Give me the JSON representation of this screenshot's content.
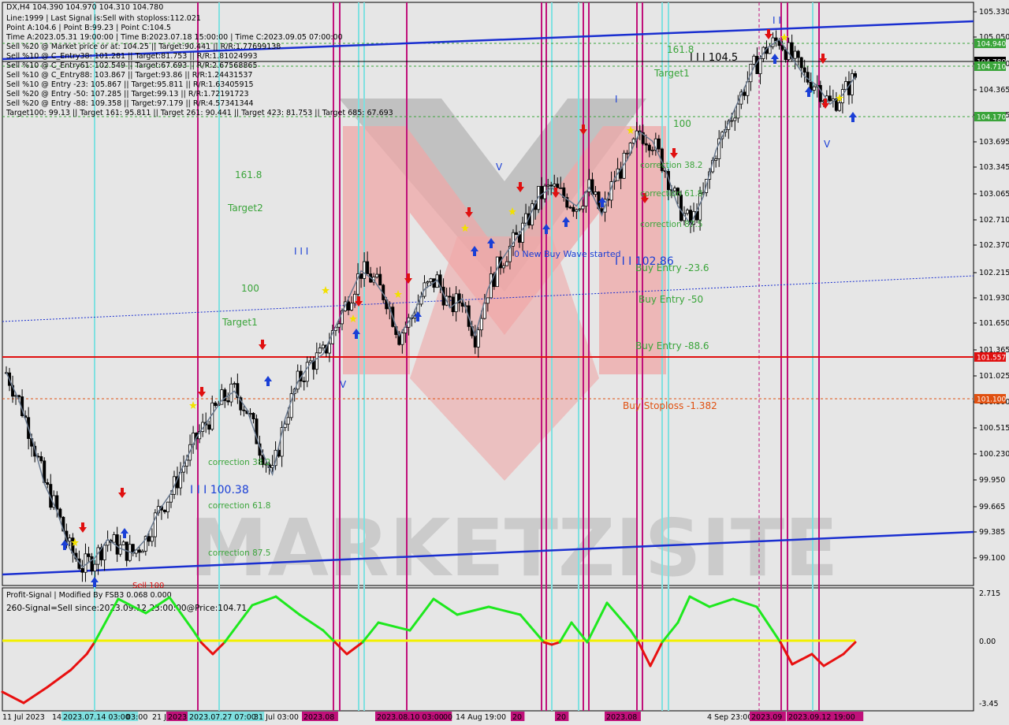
{
  "header": {
    "symbol_line": "DX,H4  104.390 104.970 104.310 104.780",
    "info_lines": [
      "Line:1999 | Last Signal is:Sell with stoploss:112.021",
      "Point A:104.6 | Point B:99.23 | Point C:104.5",
      "Time A:2023.05.31 19:00:00 | Time B:2023.07.18 15:00:00 | Time C:2023.09.05 07:00:00",
      "Sell %20 @ Market price or at: 104.25 || Target:90.441 || R/R:1.77699138",
      "Sell %10 @ C_Entry38: 101.281 || Target:81.753 || R/R:1.81024993",
      "Sell %10 @ C_Entry61: 102.549 || Target:67.693 || R/R:2.67568865",
      "Sell %10 @ C_Entry88: 103.867 || Target:93.86 || R/R:1.24431537",
      "Sell %10 @ Entry -23: 105.867 || Target:95.811 || R/R:1.63405915",
      "Sell %20 @ Entry -50: 107.285 || Target:99.13 || R/R:1.72191723",
      "Sell %20 @ Entry -88: 109.358 || Target:97.179 || R/R:4.57341344",
      "Target100: 99.13 || Target 161: 95.811 || Target 261: 90.441 || Target 423: 81.753 || Target 685: 67.693"
    ]
  },
  "price_axis": {
    "ticks": [
      "105.330",
      "105.050",
      "104.710",
      "104.365",
      "104.035",
      "103.695",
      "103.345",
      "103.065",
      "102.710",
      "102.370",
      "102.215",
      "101.930",
      "101.650",
      "101.365",
      "101.025",
      "100.800",
      "100.515",
      "100.230",
      "99.950",
      "99.665",
      "99.385",
      "99.100"
    ],
    "tags": [
      {
        "text": "104.940",
        "color": "#3aa43a"
      },
      {
        "text": "104.780",
        "color": "#000000"
      },
      {
        "text": "104.710",
        "color": "#3aa43a"
      },
      {
        "text": "104.170",
        "color": "#3aa43a"
      },
      {
        "text": "101.557",
        "color": "#e01010"
      },
      {
        "text": "101.100",
        "color": "#e05010"
      }
    ]
  },
  "time_axis": {
    "labels": [
      {
        "text": "11 Jul 2023",
        "hl": false
      },
      {
        "text": "14",
        "hl": false
      },
      {
        "text": "2023.07.14 03:00",
        "hl": true,
        "color": "cyan"
      },
      {
        "text": "03:00",
        "hl": false
      },
      {
        "text": "21 J",
        "hl": false
      },
      {
        "text": "2023",
        "hl": true,
        "color": "magenta"
      },
      {
        "text": "2023.07.27 07:00",
        "hl": true,
        "color": "cyan"
      },
      {
        "text": "31 Jul 03:00",
        "hl": false
      },
      {
        "text": "2023.08",
        "hl": true,
        "color": "magenta"
      },
      {
        "text": "2023.08.10 03:00",
        "hl": true,
        "color": "magenta"
      },
      {
        "text": "00",
        "hl": false
      },
      {
        "text": "14 Aug 19:00",
        "hl": false
      },
      {
        "text": "20",
        "hl": true,
        "color": "magenta"
      },
      {
        "text": "20",
        "hl": true,
        "color": "magenta"
      },
      {
        "text": "2023.08",
        "hl": true,
        "color": "magenta"
      },
      {
        "text": "4 Sep 23:00",
        "hl": false
      },
      {
        "text": "2023.09",
        "hl": true,
        "color": "magenta"
      },
      {
        "text": "2023.09.12 19:00",
        "hl": true,
        "color": "magenta"
      }
    ]
  },
  "annotations": {
    "green": [
      "161.8",
      "Target2",
      "100",
      "Target1",
      "correction 38.2",
      "correction 61.8",
      "correction 87.5",
      "161.8",
      "Target1",
      "100",
      "correction 38.2",
      "correction 61.8",
      "correction 87.5",
      "Buy Entry -23.6",
      "Buy Entry -50",
      "Buy Entry -88.6"
    ],
    "blue": [
      "I I I",
      "I I I 100.38",
      "0 New Buy Wave started",
      "I I I 102.86",
      "V",
      "V",
      "I",
      "V",
      "I I"
    ],
    "red": [
      "Buy Stoploss -1.382",
      "Sell 100"
    ],
    "ticker_text": "I I I 104.5"
  },
  "indicator": {
    "title": "Profit-Signal | Modified By FSB3 0.068 0.000",
    "signal_text": "260-Signal=Sell since:2023.09.12 23:00:00@Price:104.71",
    "ticks": [
      "2.715",
      "0.00",
      "-3.45"
    ]
  },
  "watermark": {
    "text": "MARKETZISITE"
  },
  "colors": {
    "background": "#e6e6e6",
    "bull_candle": "#000000",
    "ma_line": "#6a7a90",
    "trend_line": "#1a2fd0",
    "support_red": "#e01010",
    "stop_orange": "#e05010",
    "target_green": "#3aa43a",
    "vline_magenta": "#c0107a",
    "vline_cyan": "#7fe0e0",
    "osc_up": "#1ee81e",
    "osc_down": "#e81010",
    "osc_zero": "#f2f000"
  },
  "chart_data": {
    "type": "candlestick",
    "symbol": "DX,H4",
    "ylim": [
      99.1,
      105.4
    ],
    "series_close": [
      101.4,
      101.1,
      100.7,
      100.2,
      99.9,
      99.5,
      99.3,
      99.4,
      99.6,
      99.5,
      99.45,
      99.6,
      99.9,
      100.1,
      100.4,
      100.7,
      100.9,
      101.1,
      101.2,
      101.0,
      100.6,
      100.3,
      100.9,
      101.3,
      101.5,
      101.6,
      101.9,
      102.2,
      102.5,
      102.4,
      102.2,
      101.8,
      102.0,
      102.3,
      102.4,
      102.1,
      102.2,
      101.8,
      102.3,
      102.6,
      102.8,
      103.0,
      103.3,
      103.4,
      103.3,
      103.2,
      103.4,
      103.1,
      103.5,
      103.7,
      104.0,
      103.9,
      103.6,
      103.2,
      103.0,
      103.3,
      103.8,
      104.1,
      104.4,
      104.7,
      104.9,
      105.0,
      104.8,
      104.6,
      104.5,
      104.3,
      104.4,
      104.6
    ]
  }
}
